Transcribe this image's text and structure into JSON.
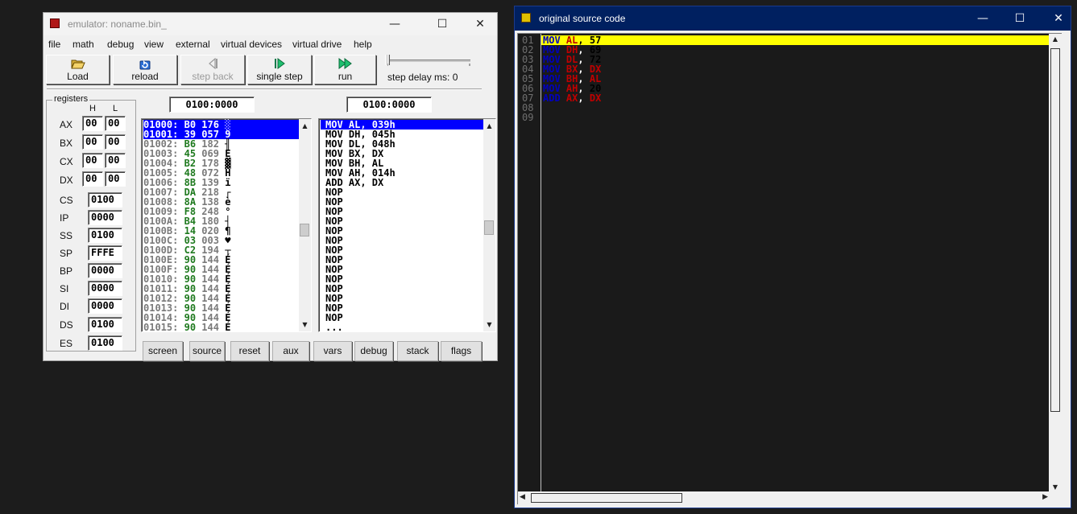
{
  "emulator": {
    "title": "emulator: noname.bin_",
    "menu": [
      "file",
      "math",
      "debug",
      "view",
      "external",
      "virtual devices",
      "virtual drive",
      "help"
    ],
    "toolbar": {
      "load": "Load",
      "reload": "reload",
      "step_back": "step back",
      "single_step": "single step",
      "run": "run",
      "step_delay_label": "step delay ms: 0"
    },
    "registers": {
      "group_label": "registers",
      "col_h": "H",
      "col_l": "L",
      "gp": [
        {
          "name": "AX",
          "h": "00",
          "l": "00"
        },
        {
          "name": "BX",
          "h": "00",
          "l": "00"
        },
        {
          "name": "CX",
          "h": "00",
          "l": "00"
        },
        {
          "name": "DX",
          "h": "00",
          "l": "00"
        }
      ],
      "seg": [
        {
          "name": "CS",
          "value": "0100"
        },
        {
          "name": "IP",
          "value": "0000"
        },
        {
          "name": "SS",
          "value": "0100"
        },
        {
          "name": "SP",
          "value": "FFFE"
        },
        {
          "name": "BP",
          "value": "0000"
        },
        {
          "name": "SI",
          "value": "0000"
        },
        {
          "name": "DI",
          "value": "0000"
        },
        {
          "name": "DS",
          "value": "0100"
        },
        {
          "name": "ES",
          "value": "0100"
        }
      ]
    },
    "memory_address": "0100:0000",
    "disasm_address": "0100:0000",
    "memory": [
      {
        "addr": "01000:",
        "hex": "B0",
        "dec": "176",
        "chr": "░"
      },
      {
        "addr": "01001:",
        "hex": "39",
        "dec": "057",
        "chr": "9"
      },
      {
        "addr": "01002:",
        "hex": "B6",
        "dec": "182",
        "chr": "╢"
      },
      {
        "addr": "01003:",
        "hex": "45",
        "dec": "069",
        "chr": "E"
      },
      {
        "addr": "01004:",
        "hex": "B2",
        "dec": "178",
        "chr": "▓"
      },
      {
        "addr": "01005:",
        "hex": "48",
        "dec": "072",
        "chr": "H"
      },
      {
        "addr": "01006:",
        "hex": "8B",
        "dec": "139",
        "chr": "ï"
      },
      {
        "addr": "01007:",
        "hex": "DA",
        "dec": "218",
        "chr": "┌"
      },
      {
        "addr": "01008:",
        "hex": "8A",
        "dec": "138",
        "chr": "è"
      },
      {
        "addr": "01009:",
        "hex": "F8",
        "dec": "248",
        "chr": "°"
      },
      {
        "addr": "0100A:",
        "hex": "B4",
        "dec": "180",
        "chr": "┤"
      },
      {
        "addr": "0100B:",
        "hex": "14",
        "dec": "020",
        "chr": "¶"
      },
      {
        "addr": "0100C:",
        "hex": "03",
        "dec": "003",
        "chr": "♥"
      },
      {
        "addr": "0100D:",
        "hex": "C2",
        "dec": "194",
        "chr": "┬"
      },
      {
        "addr": "0100E:",
        "hex": "90",
        "dec": "144",
        "chr": "É"
      },
      {
        "addr": "0100F:",
        "hex": "90",
        "dec": "144",
        "chr": "É"
      },
      {
        "addr": "01010:",
        "hex": "90",
        "dec": "144",
        "chr": "É"
      },
      {
        "addr": "01011:",
        "hex": "90",
        "dec": "144",
        "chr": "É"
      },
      {
        "addr": "01012:",
        "hex": "90",
        "dec": "144",
        "chr": "É"
      },
      {
        "addr": "01013:",
        "hex": "90",
        "dec": "144",
        "chr": "É"
      },
      {
        "addr": "01014:",
        "hex": "90",
        "dec": "144",
        "chr": "É"
      },
      {
        "addr": "01015:",
        "hex": "90",
        "dec": "144",
        "chr": "É"
      }
    ],
    "disasm": [
      "MOV AL, 039h",
      "MOV DH, 045h",
      "MOV DL, 048h",
      "MOV BX, DX",
      "MOV BH, AL",
      "MOV AH, 014h",
      "ADD AX, DX",
      "NOP",
      "NOP",
      "NOP",
      "NOP",
      "NOP",
      "NOP",
      "NOP",
      "NOP",
      "NOP",
      "NOP",
      "NOP",
      "NOP",
      "NOP",
      "NOP",
      "..."
    ],
    "bottom_buttons": [
      "screen",
      "source",
      "reset",
      "aux",
      "vars",
      "debug",
      "stack",
      "flags"
    ]
  },
  "source_window": {
    "title": "original source code",
    "line_numbers": [
      "01",
      "02",
      "03",
      "04",
      "05",
      "06",
      "07",
      "08",
      "09"
    ],
    "lines": [
      {
        "op": "MOV",
        "a": "AL",
        "b": "57"
      },
      {
        "op": "MOV",
        "a": "DH",
        "b": "69"
      },
      {
        "op": "MOV",
        "a": "DL",
        "b": "72"
      },
      {
        "op": "MOV",
        "a": "BX",
        "b": "DX"
      },
      {
        "op": "MOV",
        "a": "BH",
        "b": "AL"
      },
      {
        "op": "MOV",
        "a": "AH",
        "b": "20"
      },
      {
        "op": "ADD",
        "a": "AX",
        "b": "DX"
      }
    ]
  },
  "colors": {
    "source_titlebar": "#002060",
    "selection": "#0000ff",
    "highlight_line": "#ffff00"
  }
}
